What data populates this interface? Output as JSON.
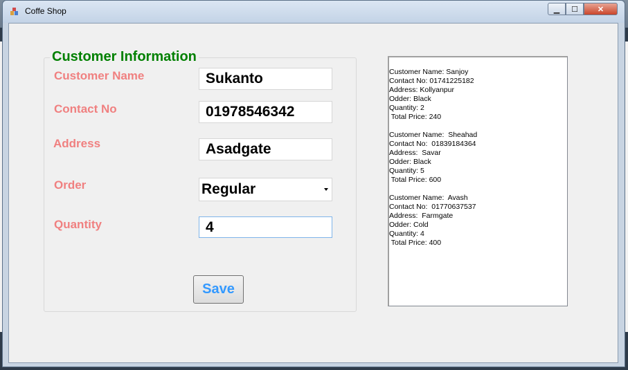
{
  "window": {
    "title": "Coffe Shop"
  },
  "caption": {
    "minimize": "▁",
    "maximize": "☐",
    "close": "✕"
  },
  "form": {
    "group_title": "Customer Information",
    "labels": {
      "customer_name": "Customer Name",
      "contact_no": "Contact No",
      "address": "Address",
      "order": "Order",
      "quantity": "Quantity"
    },
    "values": {
      "customer_name": "Sukanto",
      "contact_no": "01978546342",
      "address": "Asadgate",
      "order": "Regular",
      "quantity": "4"
    },
    "save_label": "Save"
  },
  "records": [
    {
      "lines": [
        "Customer Name: Sanjoy",
        "Contact No: 01741225182",
        "Address: Kollyanpur",
        "Odder: Black",
        "Quantity: 2",
        " Total Price: 240"
      ]
    },
    {
      "lines": [
        "Customer Name:  Sheahad",
        "Contact No:  01839184364",
        "Address:  Savar",
        "Odder: Black",
        "Quantity: 5",
        " Total Price: 600"
      ]
    },
    {
      "lines": [
        "Customer Name:  Avash",
        "Contact No:  01770637537",
        "Address:  Farmgate",
        "Odder: Cold",
        "Quantity: 4",
        " Total Price: 400"
      ]
    }
  ],
  "colors": {
    "label": "#f08080",
    "group_title": "#008000",
    "save_text": "#3399ff"
  },
  "icons": {
    "app": "coffee-app-icon"
  }
}
